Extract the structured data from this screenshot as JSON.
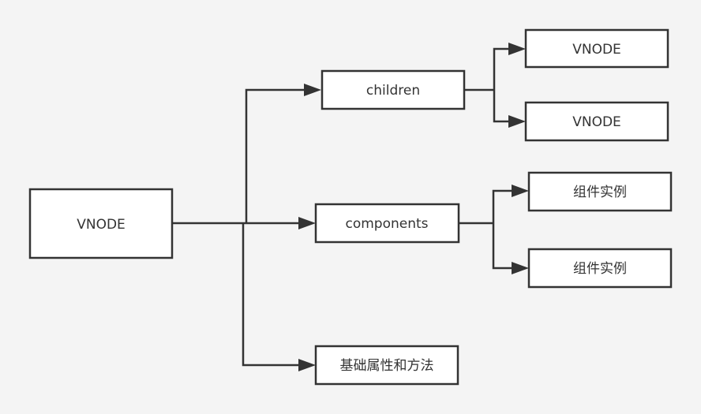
{
  "diagram": {
    "root": {
      "label": "VNODE"
    },
    "children": {
      "label": "children"
    },
    "child_vnode_1": {
      "label": "VNODE"
    },
    "child_vnode_2": {
      "label": "VNODE"
    },
    "components": {
      "label": "components"
    },
    "component_instance_1": {
      "label": "组件实例"
    },
    "component_instance_2": {
      "label": "组件实例"
    },
    "basic_props": {
      "label": "基础属性和方法"
    },
    "colors": {
      "background": "#f4f4f4",
      "stroke": "#333333",
      "box_fill": "#ffffff"
    }
  }
}
